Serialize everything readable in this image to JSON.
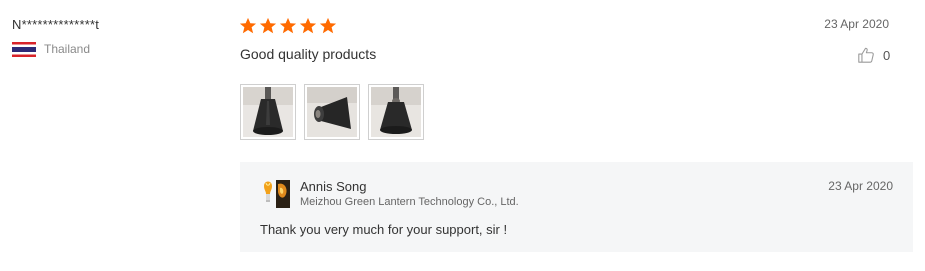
{
  "reviewer": {
    "name": "N**************t",
    "country": "Thailand",
    "flag_icon": "thailand-flag-icon"
  },
  "review": {
    "rating": 5,
    "max_rating": 5,
    "star_color": "#ff6a00",
    "date": "23 Apr 2020",
    "text": "Good quality products",
    "helpful_count": "0",
    "helpful_icon": "thumbs-up-icon",
    "photos": [
      "review-photo-lamp-1",
      "review-photo-lamp-2",
      "review-photo-lamp-3"
    ]
  },
  "reply": {
    "seller_name": "Annis Song",
    "company": "Meizhou Green Lantern Technology Co., Ltd.",
    "date": "23 Apr 2020",
    "text": "Thank you very much for your support, sir !",
    "avatar_icon": "seller-avatar"
  }
}
